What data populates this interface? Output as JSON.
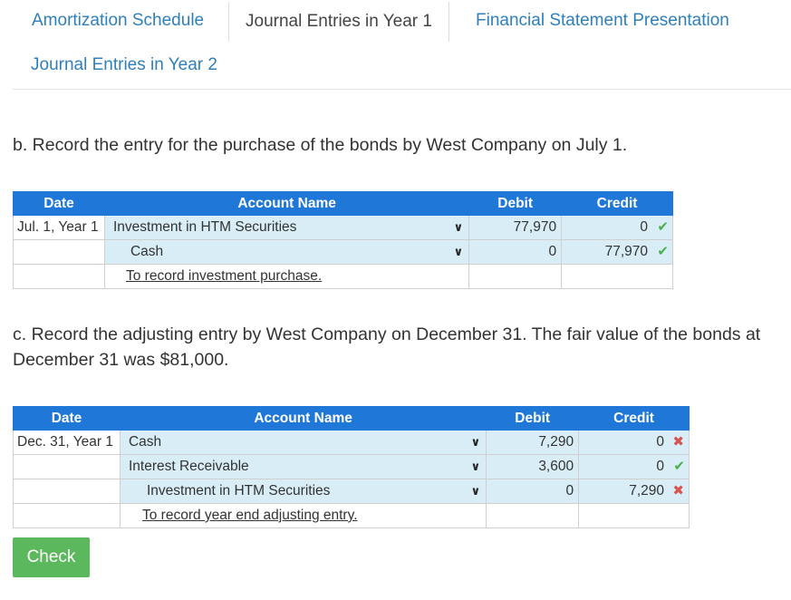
{
  "tabs": [
    {
      "label": "Amortization Schedule"
    },
    {
      "label": "Journal Entries in Year 1"
    },
    {
      "label": "Financial Statement Presentation"
    },
    {
      "label": "Journal Entries in Year 2"
    }
  ],
  "part_b": {
    "question": "b. Record the entry for the purchase of the bonds by West Company on July 1.",
    "headers": {
      "date": "Date",
      "account": "Account Name",
      "debit": "Debit",
      "credit": "Credit"
    },
    "rows": [
      {
        "date": "Jul. 1, Year 1",
        "account": "Investment in HTM Securities",
        "debit": "77,970",
        "credit": "0",
        "credit_status": "correct"
      },
      {
        "date": "",
        "account": "Cash",
        "debit": "0",
        "credit": "77,970",
        "credit_status": "correct"
      },
      {
        "date": "",
        "account": "To record investment purchase.",
        "debit": "",
        "credit": ""
      }
    ]
  },
  "part_c": {
    "question_line1": "c. Record the adjusting entry by West Company on December 31. The fair value of the bonds at",
    "question_line2": "December 31 was $81,000.",
    "headers": {
      "date": "Date",
      "account": "Account Name",
      "debit": "Debit",
      "credit": "Credit"
    },
    "rows": [
      {
        "date": "Dec. 31, Year 1",
        "account": "Cash",
        "debit": "7,290",
        "credit": "0",
        "credit_status": "incorrect"
      },
      {
        "date": "",
        "account": "Interest Receivable",
        "debit": "3,600",
        "credit": "0",
        "credit_status": "correct"
      },
      {
        "date": "",
        "account": "Investment in HTM Securities",
        "debit": "0",
        "credit": "7,290",
        "credit_status": "incorrect"
      },
      {
        "date": "",
        "account": "To record year end adjusting entry.",
        "debit": "",
        "credit": ""
      }
    ]
  },
  "check_button": "Check",
  "icons": {
    "correct": "check-mark",
    "incorrect": "x-mark",
    "dropdown": "chevron-down"
  },
  "colors": {
    "header": "#1f78d8",
    "cell_fill": "#d8edf6",
    "correct": "#4cae4c",
    "incorrect": "#d9534f",
    "check_button": "#5cb85c",
    "tab_link": "#2f7fb9"
  }
}
